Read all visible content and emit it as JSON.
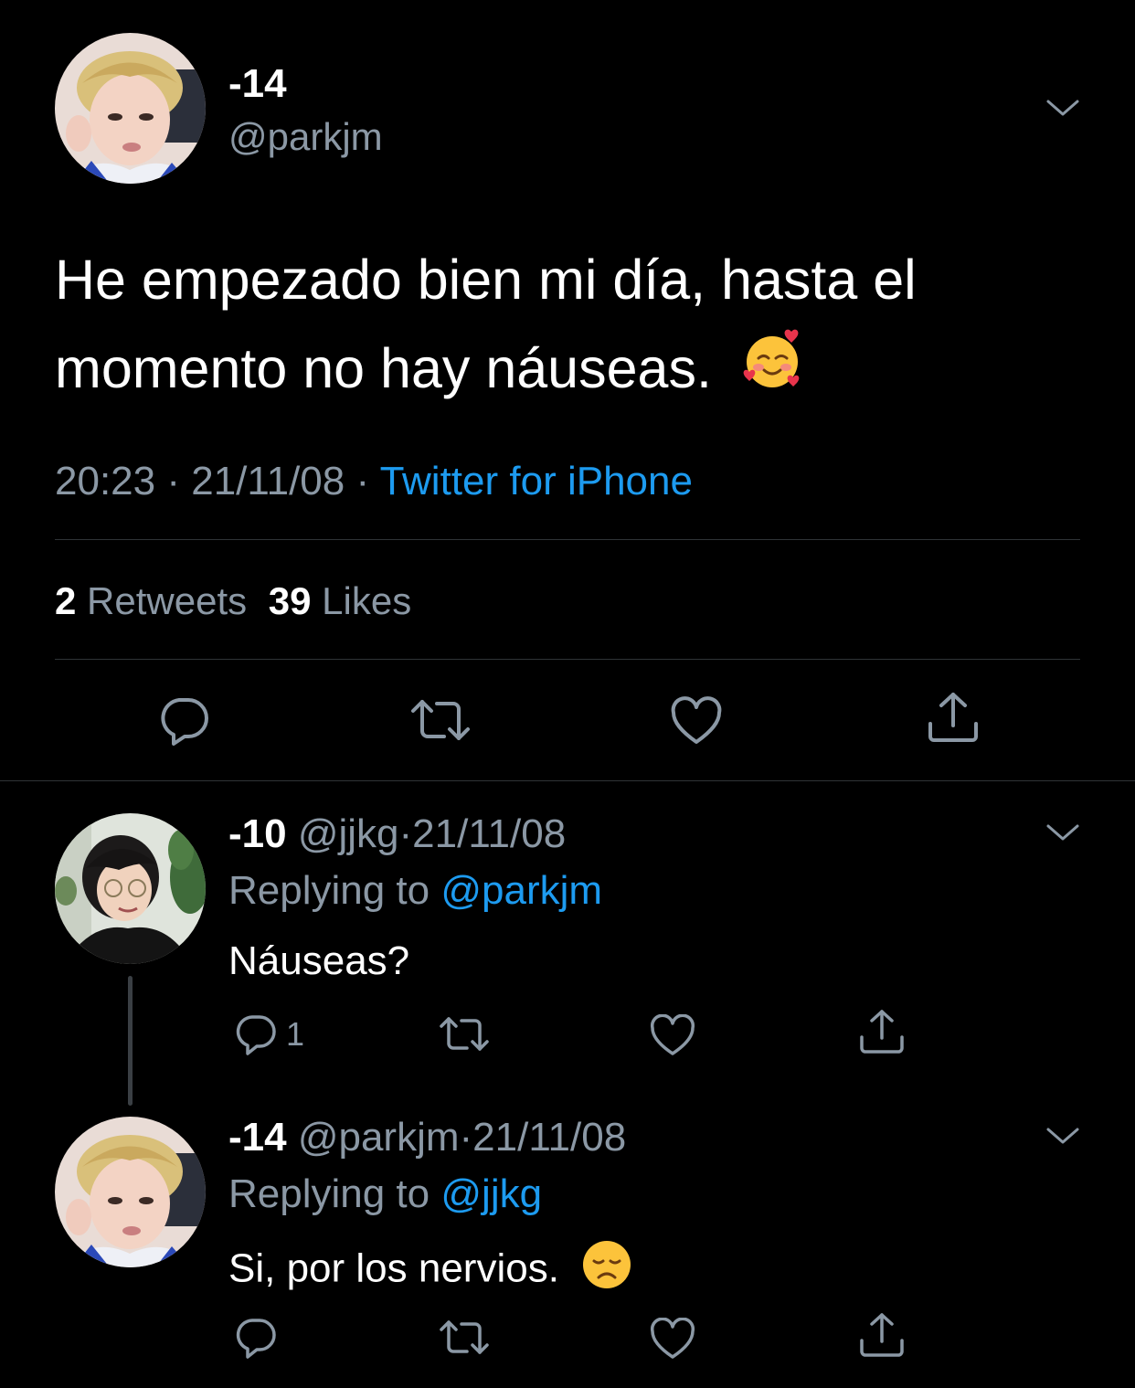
{
  "main_tweet": {
    "display_name": "-14",
    "handle": "@parkjm",
    "text": "He empezado bien mi día, hasta el momento no hay náuseas.",
    "emoji": "smiling-face-with-hearts",
    "time": "20:23",
    "date": "21/11/08",
    "separator": "·",
    "source": "Twitter for iPhone",
    "retweets_count": "2",
    "retweets_label": "Retweets",
    "likes_count": "39",
    "likes_label": "Likes"
  },
  "replies": [
    {
      "display_name": "-10",
      "handle": "@jjkg",
      "separator": "·",
      "date": "21/11/08",
      "replying_label": "Replying to",
      "replying_to": "@parkjm",
      "text": "Náuseas?",
      "reply_count": "1"
    },
    {
      "display_name": "-14",
      "handle": "@parkjm",
      "separator": "·",
      "date": "21/11/08",
      "replying_label": "Replying to",
      "replying_to": "@jjkg",
      "text": "Si, por los nervios.",
      "emoji": "disappointed-face",
      "reply_count": ""
    }
  ],
  "icons": [
    "reply-icon",
    "retweet-icon",
    "like-icon",
    "share-icon",
    "chevron-down-icon"
  ],
  "colors": {
    "background": "#000000",
    "text": "#e7e9ea",
    "muted": "#8b98a5",
    "link": "#1d9bf0",
    "divider": "#2f3336"
  }
}
